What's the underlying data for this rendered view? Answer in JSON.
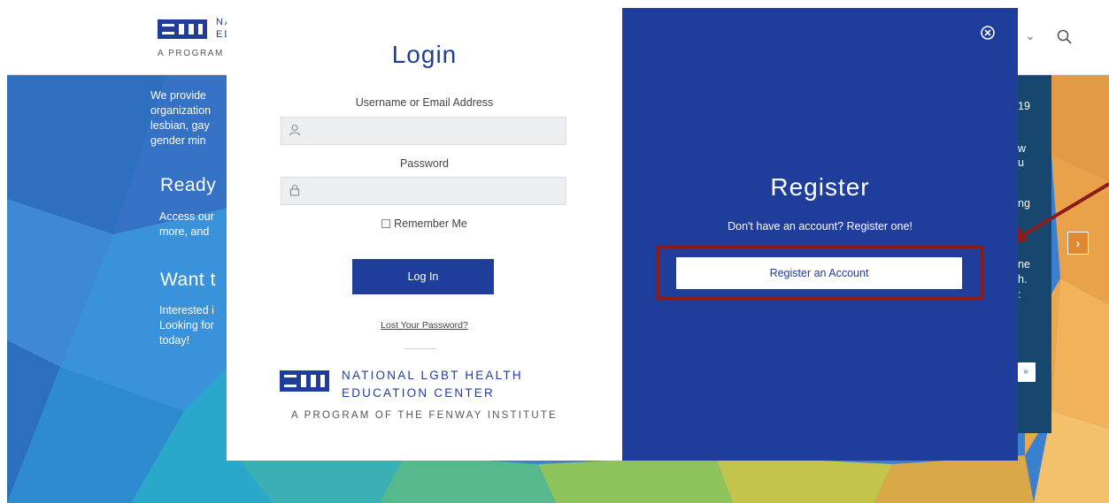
{
  "header": {
    "logo_text_line1": "NA",
    "logo_text_line2": "ED",
    "logo_sub": "A PROGRAM"
  },
  "hero": {
    "intro_lines": [
      "We provide",
      "organization",
      "lesbian, gay",
      "gender min"
    ],
    "ready_heading": "Ready",
    "ready_lines": [
      "Access our",
      "more, and"
    ],
    "want_heading": "Want t",
    "want_lines": [
      "Interested i",
      "Looking for",
      "today!"
    ]
  },
  "side_panel": {
    "lines": [
      "19",
      "w",
      "u",
      "ng",
      "ne",
      "h.",
      ":"
    ],
    "button_label": "»"
  },
  "login": {
    "title": "Login",
    "username_label": "Username or Email Address",
    "username_value": "",
    "password_label": "Password",
    "password_value": "",
    "remember_label": "Remember Me",
    "login_button": "Log In",
    "lost_password": "Lost Your Password?",
    "logo_line1": "NATIONAL LGBT HEALTH",
    "logo_line2": "EDUCATION CENTER",
    "logo_sub": "A PROGRAM OF THE FENWAY INSTITUTE"
  },
  "register": {
    "title": "Register",
    "subtitle": "Don't have an account? Register one!",
    "button": "Register an Account"
  },
  "colors": {
    "brand_blue": "#1f3d9a",
    "annotation_red": "#8b1c1c",
    "side_panel": "#17476e"
  },
  "icons": {
    "search": "search-icon",
    "close": "close-icon",
    "user": "user-icon",
    "lock": "lock-icon",
    "next": "chevron-right-icon"
  }
}
